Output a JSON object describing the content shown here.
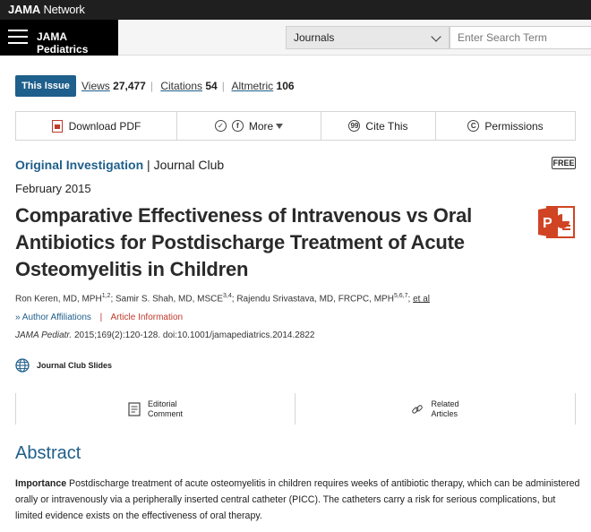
{
  "network": {
    "brand_bold": "JAMA",
    "brand_rest": " Network"
  },
  "journal_bar": {
    "journal_name": "JAMA Pediatrics",
    "journals_select": "Journals",
    "search_placeholder": "Enter Search Term"
  },
  "issue": {
    "this_issue_label": "This Issue",
    "views_label": "Views",
    "views_value": "27,477",
    "citations_label": "Citations",
    "citations_value": "54",
    "altmetric_label": "Altmetric",
    "altmetric_value": "106"
  },
  "toolbar": {
    "download_pdf": "Download PDF",
    "more": "More",
    "cite_this": "Cite This",
    "permissions": "Permissions",
    "twitter_glyph": "✓",
    "facebook_glyph": "f",
    "cite_glyph": "99",
    "permissions_glyph": "C"
  },
  "article": {
    "type_primary": "Original Investigation",
    "type_sep": " | ",
    "type_secondary": "Journal Club",
    "free_badge": "FREE",
    "date": "February 2015",
    "title": "Comparative Effectiveness of Intravenous vs Oral Antibiotics for Postdischarge Treatment of Acute Osteomyelitis in Children",
    "authors": [
      {
        "name": "Ron Keren, MD, MPH",
        "sup": "1,2"
      },
      {
        "name": "Samir S. Shah, MD, MSCE",
        "sup": "3,4"
      },
      {
        "name": "Rajendu Srivastava, MD, FRCPC, MPH",
        "sup": "5,6,7"
      }
    ],
    "author_sep": "; ",
    "et_al": "et al",
    "author_affiliations": "Author Affiliations",
    "article_information": "Article Information",
    "affil_sep": "|",
    "citation_journal": "JAMA Pediatr.",
    "citation_rest": " 2015;169(2):120-128. doi:10.1001/jamapediatrics.2014.2822",
    "journal_club_slides": "Journal Club Slides"
  },
  "related": {
    "editorial_line1": "Editorial",
    "editorial_line2": "Comment",
    "related_line1": "Related",
    "related_line2": "Articles"
  },
  "abstract": {
    "heading": "Abstract",
    "importance_label": "Importance",
    "importance_text": "  Postdischarge treatment of acute osteomyelitis in children requires weeks of antibiotic therapy, which can be administered orally or intravenously via a peripherally inserted central catheter (PICC). The catheters carry a risk for serious complications, but limited evidence exists on the effectiveness of oral therapy."
  },
  "colors": {
    "accent": "#1f5f8b",
    "link_red": "#c0392b",
    "ppt_orange": "#d04423",
    "dark_bar": "#1f1f1f"
  }
}
